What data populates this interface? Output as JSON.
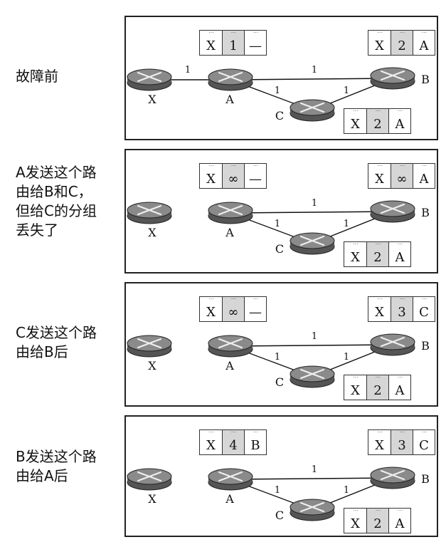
{
  "nodes": {
    "x": "X",
    "a": "A",
    "b": "B",
    "c": "C"
  },
  "link_costs": {
    "xa": "1",
    "ab": "1",
    "ac": "1",
    "cb": "1"
  },
  "cell_marks": "˙˙˙",
  "panels": [
    {
      "caption": "故障前",
      "x_link": true,
      "tables": {
        "a": [
          "X",
          "1",
          "—"
        ],
        "b": [
          "X",
          "2",
          "A"
        ],
        "c": [
          "X",
          "2",
          "A"
        ]
      }
    },
    {
      "caption": "A发送这个路\n由给B和C，\n但给C的分组\n丢失了",
      "x_link": false,
      "tables": {
        "a": [
          "X",
          "∞",
          "—"
        ],
        "b": [
          "X",
          "∞",
          "A"
        ],
        "c": [
          "X",
          "2",
          "A"
        ]
      }
    },
    {
      "caption": "C发送这个路\n由给B后",
      "x_link": false,
      "tables": {
        "a": [
          "X",
          "∞",
          "—"
        ],
        "b": [
          "X",
          "3",
          "C"
        ],
        "c": [
          "X",
          "2",
          "A"
        ]
      }
    },
    {
      "caption": "B发送这个路\n由给A后",
      "x_link": false,
      "tables": {
        "a": [
          "X",
          "4",
          "B"
        ],
        "b": [
          "X",
          "3",
          "C"
        ],
        "c": [
          "X",
          "2",
          "A"
        ]
      }
    }
  ]
}
